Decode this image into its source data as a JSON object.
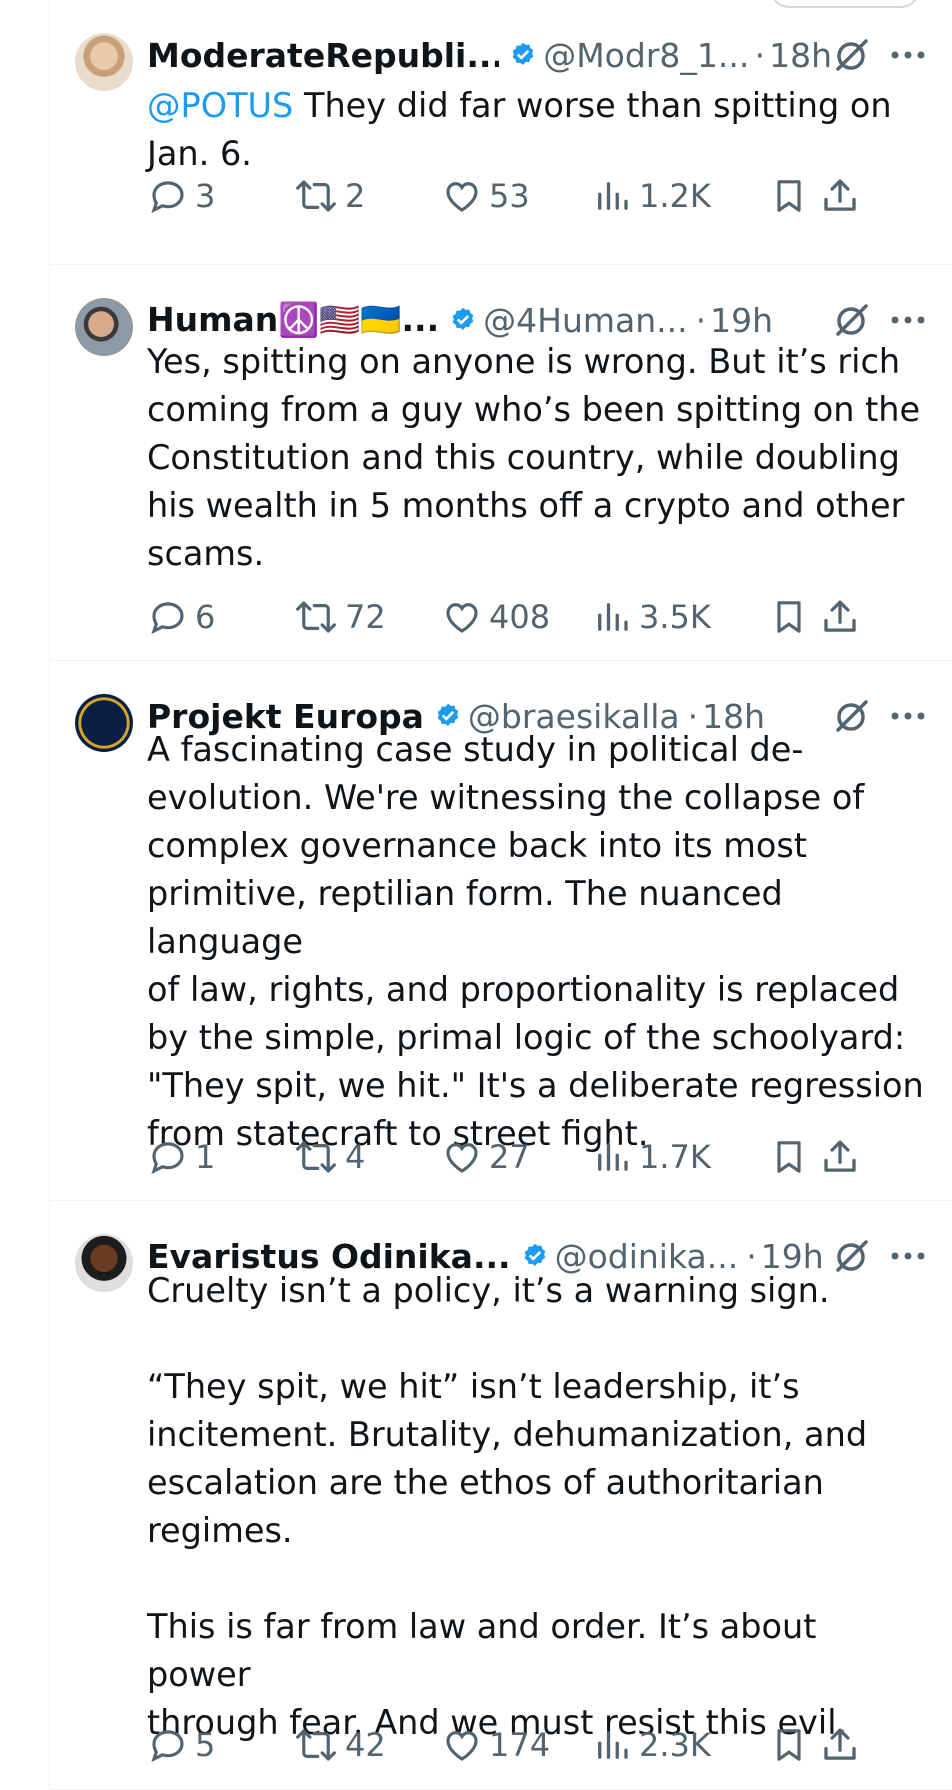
{
  "colors": {
    "text": "#0f1419",
    "secondary": "#536471",
    "accent": "#1d9bf0",
    "divider": "#eff3f4"
  },
  "tweets": [
    {
      "name": "ModerateRepubli...",
      "handle": "@Modr8_1...",
      "time": "18h",
      "mention": "@POTUS",
      "text": " They did far worse than spitting on\nJan. 6.",
      "replies": "3",
      "retweets": "2",
      "likes": "53",
      "views": "1.2K"
    },
    {
      "name": "Human☮️🇺🇸🇺🇦...",
      "handle": "@4Human...",
      "time": "19h",
      "mention": "",
      "text": "Yes, spitting on anyone is wrong. But it’s rich\ncoming from a guy who’s been spitting on the\nConstitution and this country, while doubling\nhis wealth in 5 months off a crypto and other\nscams.",
      "replies": "6",
      "retweets": "72",
      "likes": "408",
      "views": "3.5K"
    },
    {
      "name": "Projekt Europa",
      "handle": "@braesikalla",
      "time": "18h",
      "mention": "",
      "text": "A fascinating case study in political de-\nevolution. We're witnessing the collapse of\ncomplex governance back into its most\nprimitive, reptilian form. The nuanced language\nof law, rights, and proportionality is replaced\nby the simple, primal logic of the schoolyard:\n\"They spit, we hit.\" It's a deliberate regression\nfrom statecraft to street fight.",
      "replies": "1",
      "retweets": "4",
      "likes": "27",
      "views": "1.7K"
    },
    {
      "name": "Evaristus Odinika...",
      "handle": "@odinika...",
      "time": "19h",
      "mention": "",
      "text": "Cruelty isn’t a policy, it’s a warning sign.\n\n“They spit, we hit” isn’t leadership, it’s\nincitement. Brutality, dehumanization, and\nescalation are the ethos of authoritarian\nregimes.\n\nThis is far from law and order. It’s about power\nthrough fear. And we must resist this evil.",
      "replies": "5",
      "retweets": "42",
      "likes": "174",
      "views": "2.3K"
    }
  ]
}
